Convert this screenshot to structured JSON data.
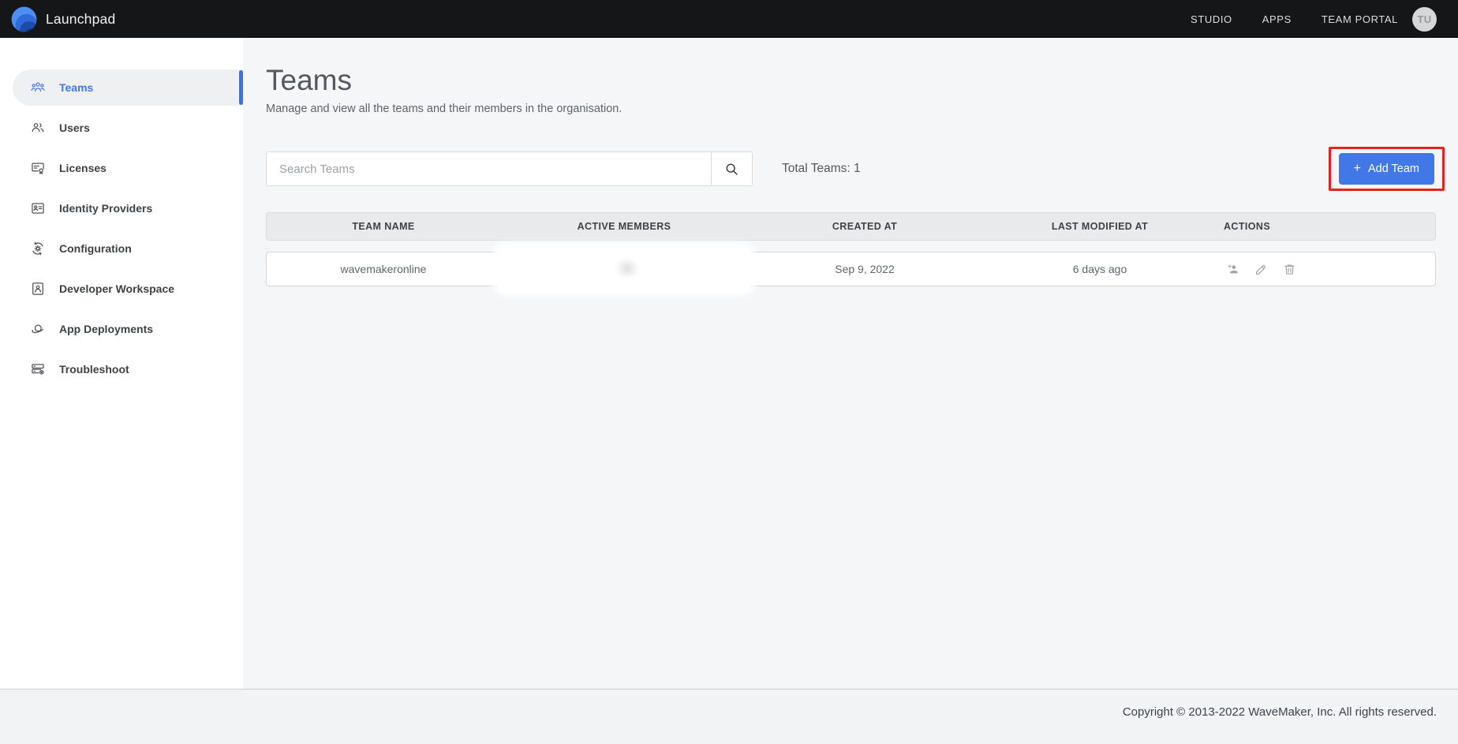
{
  "topbar": {
    "app_title": "Launchpad",
    "nav": [
      {
        "label": "STUDIO"
      },
      {
        "label": "APPS"
      },
      {
        "label": "TEAM PORTAL"
      }
    ],
    "avatar_initials": "TU"
  },
  "sidebar": {
    "items": [
      {
        "label": "Teams",
        "icon": "teams-icon",
        "selected": true
      },
      {
        "label": "Users",
        "icon": "users-icon",
        "selected": false
      },
      {
        "label": "Licenses",
        "icon": "licenses-icon",
        "selected": false
      },
      {
        "label": "Identity Providers",
        "icon": "identity-providers-icon",
        "selected": false
      },
      {
        "label": "Configuration",
        "icon": "configuration-icon",
        "selected": false
      },
      {
        "label": "Developer Workspace",
        "icon": "developer-workspace-icon",
        "selected": false
      },
      {
        "label": "App Deployments",
        "icon": "app-deployments-icon",
        "selected": false
      },
      {
        "label": "Troubleshoot",
        "icon": "troubleshoot-icon",
        "selected": false
      }
    ]
  },
  "page": {
    "title": "Teams",
    "subtitle": "Manage and view all the teams and their members in the organisation.",
    "search_placeholder": "Search Teams",
    "search_value": "",
    "total_label": "Total Teams: 1",
    "add_plus": "+",
    "add_team_label": "Add Team"
  },
  "table": {
    "headers": [
      "TEAM NAME",
      "ACTIVE MEMBERS",
      "CREATED AT",
      "LAST MODIFIED AT",
      "ACTIONS"
    ],
    "rows": [
      {
        "team_name": "wavemakeronline",
        "active_members": "",
        "active_members_redacted": true,
        "created_at": "Sep 9, 2022",
        "last_modified_at": "6 days ago",
        "actions": [
          "add-member",
          "edit",
          "delete"
        ]
      }
    ]
  },
  "footer": {
    "copyright": "Copyright © 2013-2022 WaveMaker, Inc. All rights reserved."
  },
  "colors": {
    "topbar_bg": "#151618",
    "sidebar_selected_blue": "#4478e9",
    "primary_button_blue": "#4177e6",
    "annotation_red": "#e8211d",
    "main_bg": "#f5f6f8",
    "table_header_bg": "#e9eaec"
  }
}
